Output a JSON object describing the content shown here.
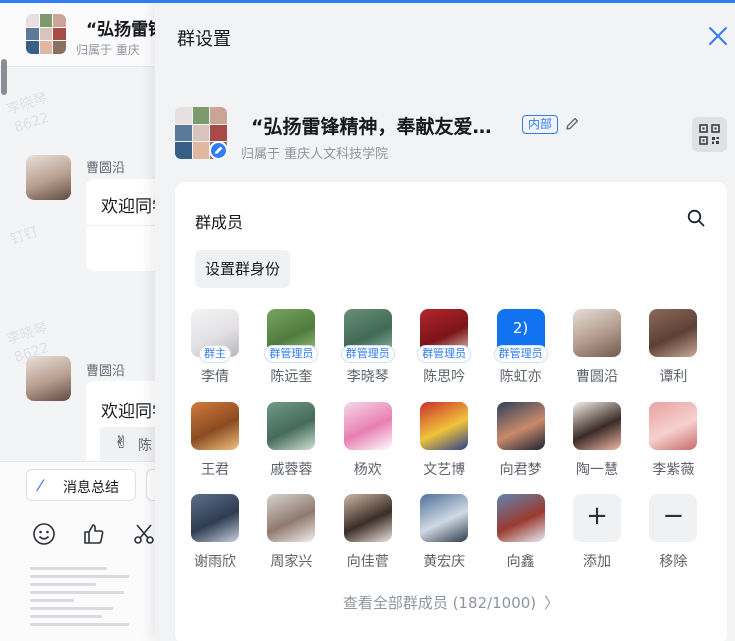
{
  "chat": {
    "title": "“弘扬雷锋",
    "org": "归属于 重庆",
    "watermark": [
      "李晓琴",
      "8622",
      "钉钉",
      "李晓琴",
      "8622"
    ],
    "messages": [
      {
        "sender": "曹圆沿",
        "text": "欢迎同学"
      },
      {
        "sender": "曹圆沿",
        "text": "欢迎同学"
      }
    ],
    "quote_text": "陈",
    "summary_label": "消息总结"
  },
  "panel": {
    "title": "群设置",
    "group": {
      "name": "“弘扬雷锋精神，奉献友爱…",
      "badge": "内部",
      "org": "归属于 重庆人文科技学院"
    },
    "members_section": {
      "title": "群成员",
      "identity_button": "设置群身份",
      "members": [
        {
          "name": "李倩",
          "role": "群主",
          "colors": [
            "#f3f4f6",
            "#e3e1e4",
            "#b9b5b8"
          ]
        },
        {
          "name": "陈远奎",
          "role": "群管理员",
          "colors": [
            "#7aa35f",
            "#4e7c3c",
            "#a9c78b"
          ]
        },
        {
          "name": "李晓琴",
          "role": "群管理员",
          "colors": [
            "#6a8f7a",
            "#3f6a55",
            "#9fbbaa"
          ]
        },
        {
          "name": "陈思吟",
          "role": "群管理员",
          "colors": [
            "#b3262c",
            "#7b1419",
            "#e8d3c2"
          ]
        },
        {
          "name": "陈虹亦",
          "role": "群管理员",
          "avatar_text": "2)",
          "colors": [
            "#1273f0",
            "#1273f0",
            "#1273f0"
          ]
        },
        {
          "name": "曹圆沿",
          "colors": [
            "#e8e0da",
            "#b29a8c",
            "#6f5a50"
          ]
        },
        {
          "name": "谭利",
          "colors": [
            "#8b6a5a",
            "#5d4035",
            "#c9a996"
          ]
        },
        {
          "name": "王君",
          "colors": [
            "#d27a3c",
            "#8a4b22",
            "#f2c27d"
          ]
        },
        {
          "name": "戚蓉蓉",
          "colors": [
            "#6e9a86",
            "#466a5a",
            "#cfe1d5"
          ]
        },
        {
          "name": "杨欢",
          "colors": [
            "#f4d9e8",
            "#e87fb2",
            "#ffffff"
          ]
        },
        {
          "name": "文艺博",
          "colors": [
            "#c9302c",
            "#f0c43a",
            "#2a3f8f"
          ]
        },
        {
          "name": "向君梦",
          "colors": [
            "#2f3f5c",
            "#c98a6a",
            "#1b2336"
          ]
        },
        {
          "name": "陶一慧",
          "colors": [
            "#f7efe8",
            "#3a2b26",
            "#f1b9a6"
          ]
        },
        {
          "name": "李紫薇",
          "colors": [
            "#e9a2a0",
            "#f5d1cf",
            "#c96a6a"
          ]
        },
        {
          "name": "谢雨欣",
          "colors": [
            "#5c6f88",
            "#2f3c52",
            "#c7d2df"
          ]
        },
        {
          "name": "周家兴",
          "colors": [
            "#d9d3cf",
            "#8f7a70",
            "#f3efec"
          ]
        },
        {
          "name": "向佳菅",
          "colors": [
            "#cdb7a6",
            "#3b2d27",
            "#efe5dc"
          ]
        },
        {
          "name": "黄宏庆",
          "colors": [
            "#4f6f98",
            "#cfd9e4",
            "#2e3a4a"
          ]
        },
        {
          "name": "向鑫",
          "colors": [
            "#5f85b3",
            "#9a3a2f",
            "#e8eef6"
          ]
        }
      ],
      "add_label": "添加",
      "remove_label": "移除",
      "view_all": "查看全部群成员 (182/1000)"
    }
  },
  "colors": {
    "accent": "#2f7cf6",
    "panel_bg": "#f2f3f5",
    "text": "#171a1d",
    "muted": "#8f959e"
  }
}
